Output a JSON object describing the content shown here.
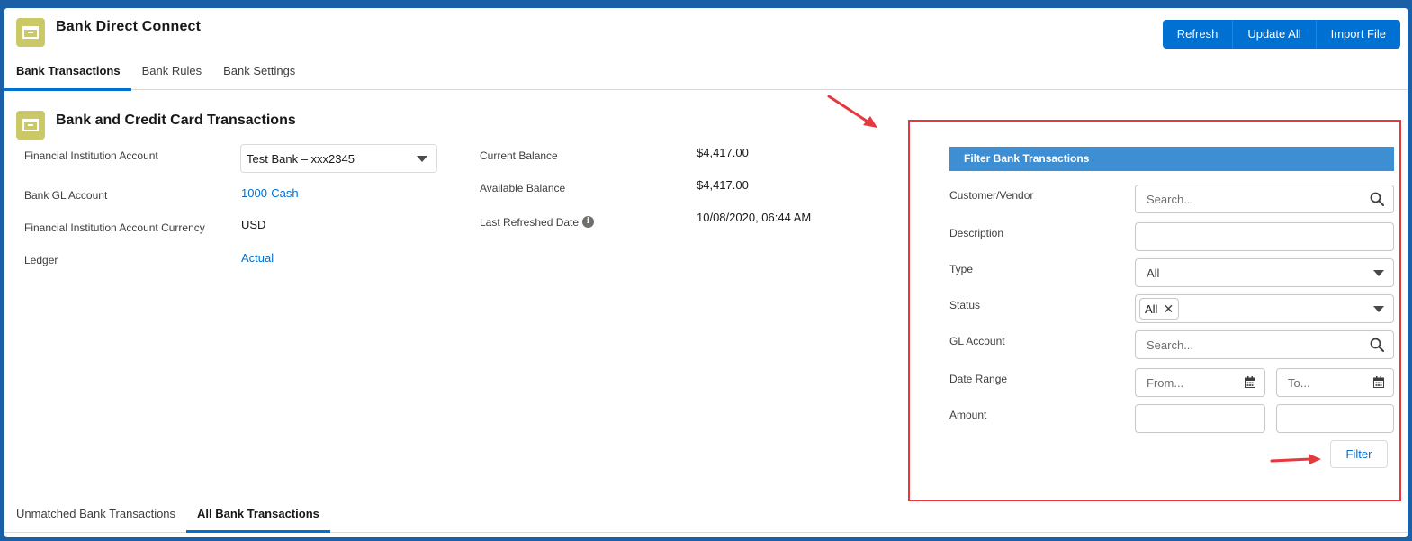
{
  "header": {
    "title": "Bank Direct Connect",
    "buttons": [
      "Refresh",
      "Update All",
      "Import File"
    ]
  },
  "tabs": [
    "Bank Transactions",
    "Bank Rules",
    "Bank Settings"
  ],
  "section": {
    "title": "Bank and Credit Card Transactions",
    "left_fields": [
      {
        "label": "Financial Institution Account",
        "value": "Test Bank – xxx2345"
      },
      {
        "label": "Bank GL Account",
        "value": "1000-Cash"
      },
      {
        "label": "Financial Institution Account Currency",
        "value": "USD"
      },
      {
        "label": "Ledger",
        "value": "Actual"
      }
    ],
    "right_fields": [
      {
        "label": "Current Balance",
        "value": "$4,417.00"
      },
      {
        "label": "Available Balance",
        "value": "$4,417.00"
      },
      {
        "label": "Last Refreshed Date",
        "value": "10/08/2020, 06:44 AM"
      }
    ]
  },
  "filter": {
    "title": "Filter Bank Transactions",
    "labels": [
      "Customer/Vendor",
      "Description",
      "Type",
      "Status",
      "GL Account",
      "Date Range",
      "Amount"
    ],
    "customer_placeholder": "Search...",
    "type_value": "All",
    "status_pill": "All",
    "gl_placeholder": "Search...",
    "date_from_placeholder": "From...",
    "date_to_placeholder": "To...",
    "button": "Filter"
  },
  "bottom_tabs": [
    "Unmatched Bank Transactions",
    "All Bank Transactions"
  ],
  "colors": {
    "brand_blue": "#0070d2",
    "filter_header": "#3d8ed3",
    "highlight_red": "#e5393d",
    "app_icon": "#cbc967"
  }
}
